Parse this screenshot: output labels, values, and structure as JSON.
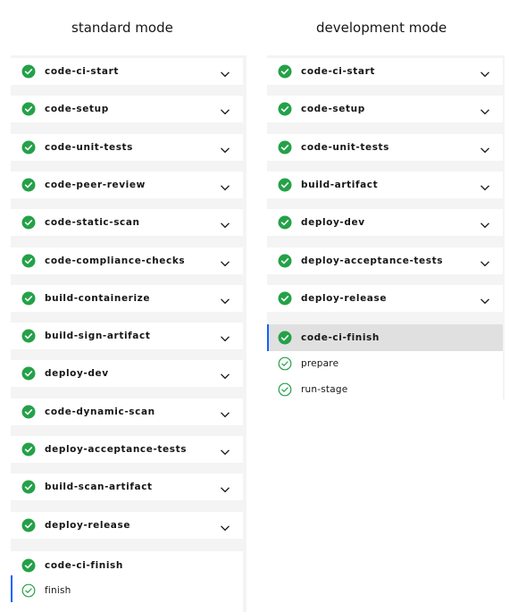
{
  "headings": {
    "standard": "standard mode",
    "development": "development mode"
  },
  "colors": {
    "success": "#24a148",
    "active_indicator": "#0f62fe"
  },
  "standard": {
    "steps": [
      "code-ci-start",
      "code-setup",
      "code-unit-tests",
      "code-peer-review",
      "code-static-scan",
      "code-compliance-checks",
      "build-containerize",
      "build-sign-artifact",
      "deploy-dev",
      "code-dynamic-scan",
      "deploy-acceptance-tests",
      "build-scan-artifact",
      "deploy-release"
    ],
    "final_step": "code-ci-finish",
    "substeps": [
      "finish"
    ]
  },
  "development": {
    "steps": [
      "code-ci-start",
      "code-setup",
      "code-unit-tests",
      "build-artifact",
      "deploy-dev",
      "deploy-acceptance-tests",
      "deploy-release"
    ],
    "final_step": "code-ci-finish",
    "substeps": [
      "prepare",
      "run-stage"
    ]
  }
}
